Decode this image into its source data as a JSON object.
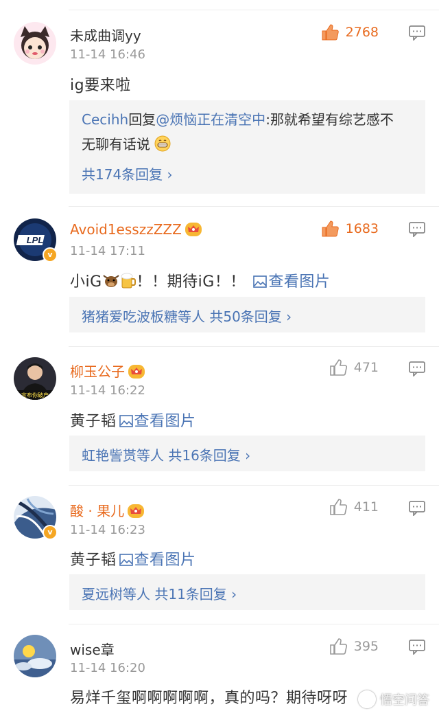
{
  "comments": [
    {
      "user": "未成曲调yy",
      "time": "11-14 16:46",
      "likes": "2768",
      "text": "ig要来啦",
      "reply": {
        "from": "Cecihh",
        "verb": "回复",
        "mention": "@烦恼正在清空中",
        "colon": ":",
        "text_line1": "那就希望有综艺感不",
        "text_line2": "无聊有话说",
        "more": "共174条回复 ›"
      }
    },
    {
      "user": "Avoid1esszzZZZ",
      "time": "11-14 17:11",
      "likes": "1683",
      "text": "小iG",
      "text_tail": "！！期待iG！！",
      "image_link": "查看图片",
      "reply": {
        "names": "猪猪爱吃波板糖等人",
        "count": "共50条回复 ›"
      }
    },
    {
      "user": "柳玉公子",
      "time": "11-14 16:22",
      "likes": "471",
      "text": "黄子韬",
      "image_link": "查看图片",
      "reply": {
        "names": "虹艳訾贳等人",
        "count": "共16条回复 ›"
      }
    },
    {
      "user": "酸 · 果儿",
      "time": "11-14 16:23",
      "likes": "411",
      "text": "黄子韬",
      "image_link": "查看图片",
      "reply": {
        "names": "夏远树等人",
        "count": "共11条回复 ›"
      }
    },
    {
      "user": "wise章",
      "time": "11-14 16:20",
      "likes": "395",
      "text": "易烊千玺啊啊啊啊啊，真的吗？期待呀呀"
    }
  ],
  "avatar2_text": "LPL",
  "avatar3_text": "宣布你破产",
  "watermark": "悟空问答",
  "colors": {
    "accent": "#e86a1e",
    "link": "#4a74b4",
    "muted": "#999999",
    "box": "#f4f4f4"
  }
}
